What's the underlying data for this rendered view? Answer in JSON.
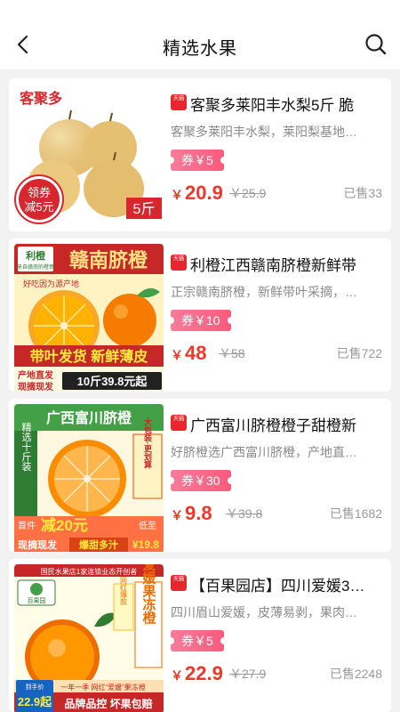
{
  "header": {
    "title": "精选水果",
    "back_icon": "chevron-left-icon",
    "search_icon": "search-icon"
  },
  "colors": {
    "price": "#f03728",
    "coupon": "#fb5a7d",
    "tmall_badge": "#e8262d"
  },
  "products": [
    {
      "title": "客聚多莱阳丰水梨5斤 脆",
      "description": "客聚多莱阳丰水梨，莱阳梨基地…",
      "coupon": "券￥5",
      "currency": "￥",
      "price": "20.9",
      "original_price": "￥25.9",
      "sold": "已售33",
      "image_texts": {
        "brand": "客聚多",
        "promo_line1": "领券",
        "promo_line2": "减5元",
        "weight": "5斤"
      }
    },
    {
      "title": "利橙江西赣南脐橙新鲜带",
      "description": "正宗赣南脐橙，新鲜带叶采摘，…",
      "coupon": "券￥10",
      "currency": "￥",
      "price": "48",
      "original_price": "￥58",
      "sold": "已售722",
      "image_texts": {
        "brand": "利橙",
        "brand_sub": "来自赣南的橙意",
        "headline": "赣南脐橙",
        "slogan": "好吃因为源产地",
        "banner": "带叶发货 新鲜薄皮",
        "tag1": "产地直发",
        "tag2": "现摘现发",
        "deal": "10斤39.8元起"
      }
    },
    {
      "title": "广西富川脐橙橙子甜橙新",
      "description": "好脐橙选广西富川脐橙，产地直…",
      "coupon": "券￥30",
      "currency": "￥",
      "price": "9.8",
      "original_price": "￥39.8",
      "sold": "已售1682",
      "image_texts": {
        "headline": "广西富川脐橙",
        "side_tag": "精选十斤装",
        "pack_tag": "大包装·更划算",
        "first_order": "首件",
        "discount": "减20元",
        "low_price": "低至",
        "low_value": "¥19.8",
        "bottom_left": "现摘现发",
        "bottom_mid": "爆甜多汁"
      }
    },
    {
      "title": "【百果园店】四川爱媛3…",
      "description": "四川眉山爱媛，皮薄易剥，果肉…",
      "coupon": "券￥5",
      "currency": "￥",
      "price": "22.9",
      "original_price": "￥27.9",
      "sold": "已售2248",
      "image_texts": {
        "top_banner": "国民水果店1家连锁业态开创者",
        "brand": "百果园",
        "headline": "爱媛果冻橙",
        "side_note": "网红爆款",
        "bottom_line": "一年一季 网红“爱媛”果冻橙",
        "price_label": "到手价",
        "price_value": "22.9起",
        "guarantee": "品牌品控 坏果包赔"
      }
    }
  ]
}
